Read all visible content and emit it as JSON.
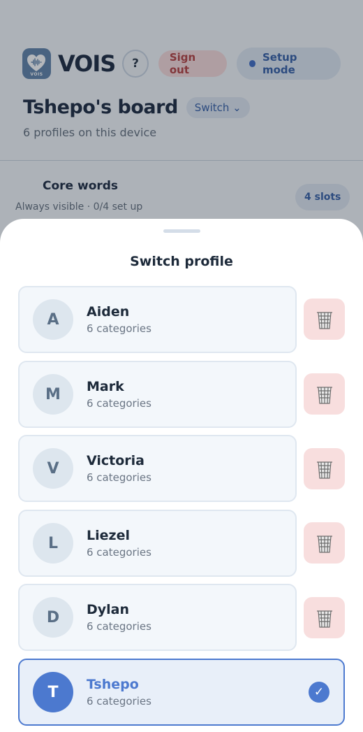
{
  "header": {
    "brand": "VOIS",
    "logo_caption": "VOIS",
    "help_label": "?",
    "sign_out_label": "Sign out",
    "setup_mode_label": "Setup mode"
  },
  "board": {
    "title": "Tshepo's board",
    "switch_label": "Switch ⌄",
    "subtitle": "6 profiles on this device"
  },
  "core_words": {
    "title": "Core words",
    "subtitle": "Always visible · 0/4 set up",
    "slots_label": "4 slots"
  },
  "sheet": {
    "title": "Switch profile",
    "profiles": [
      {
        "initial": "A",
        "name": "Aiden",
        "categories": "6 categories"
      },
      {
        "initial": "M",
        "name": "Mark",
        "categories": "6 categories"
      },
      {
        "initial": "V",
        "name": "Victoria",
        "categories": "6 categories"
      },
      {
        "initial": "L",
        "name": "Liezel",
        "categories": "6 categories"
      },
      {
        "initial": "D",
        "name": "Dylan",
        "categories": "6 categories"
      },
      {
        "initial": "T",
        "name": "Tshepo",
        "categories": "6 categories",
        "selected": true
      }
    ],
    "check_glyph": "✓"
  },
  "icons": {
    "logo": "heart-waveform-icon",
    "setup_dot": "dot-icon",
    "delete": "trash-icon",
    "selected": "checkmark-icon"
  },
  "colors": {
    "accent": "#4c79cf",
    "danger_bg": "#f8dede",
    "sign_out_text": "#b23a3a"
  }
}
